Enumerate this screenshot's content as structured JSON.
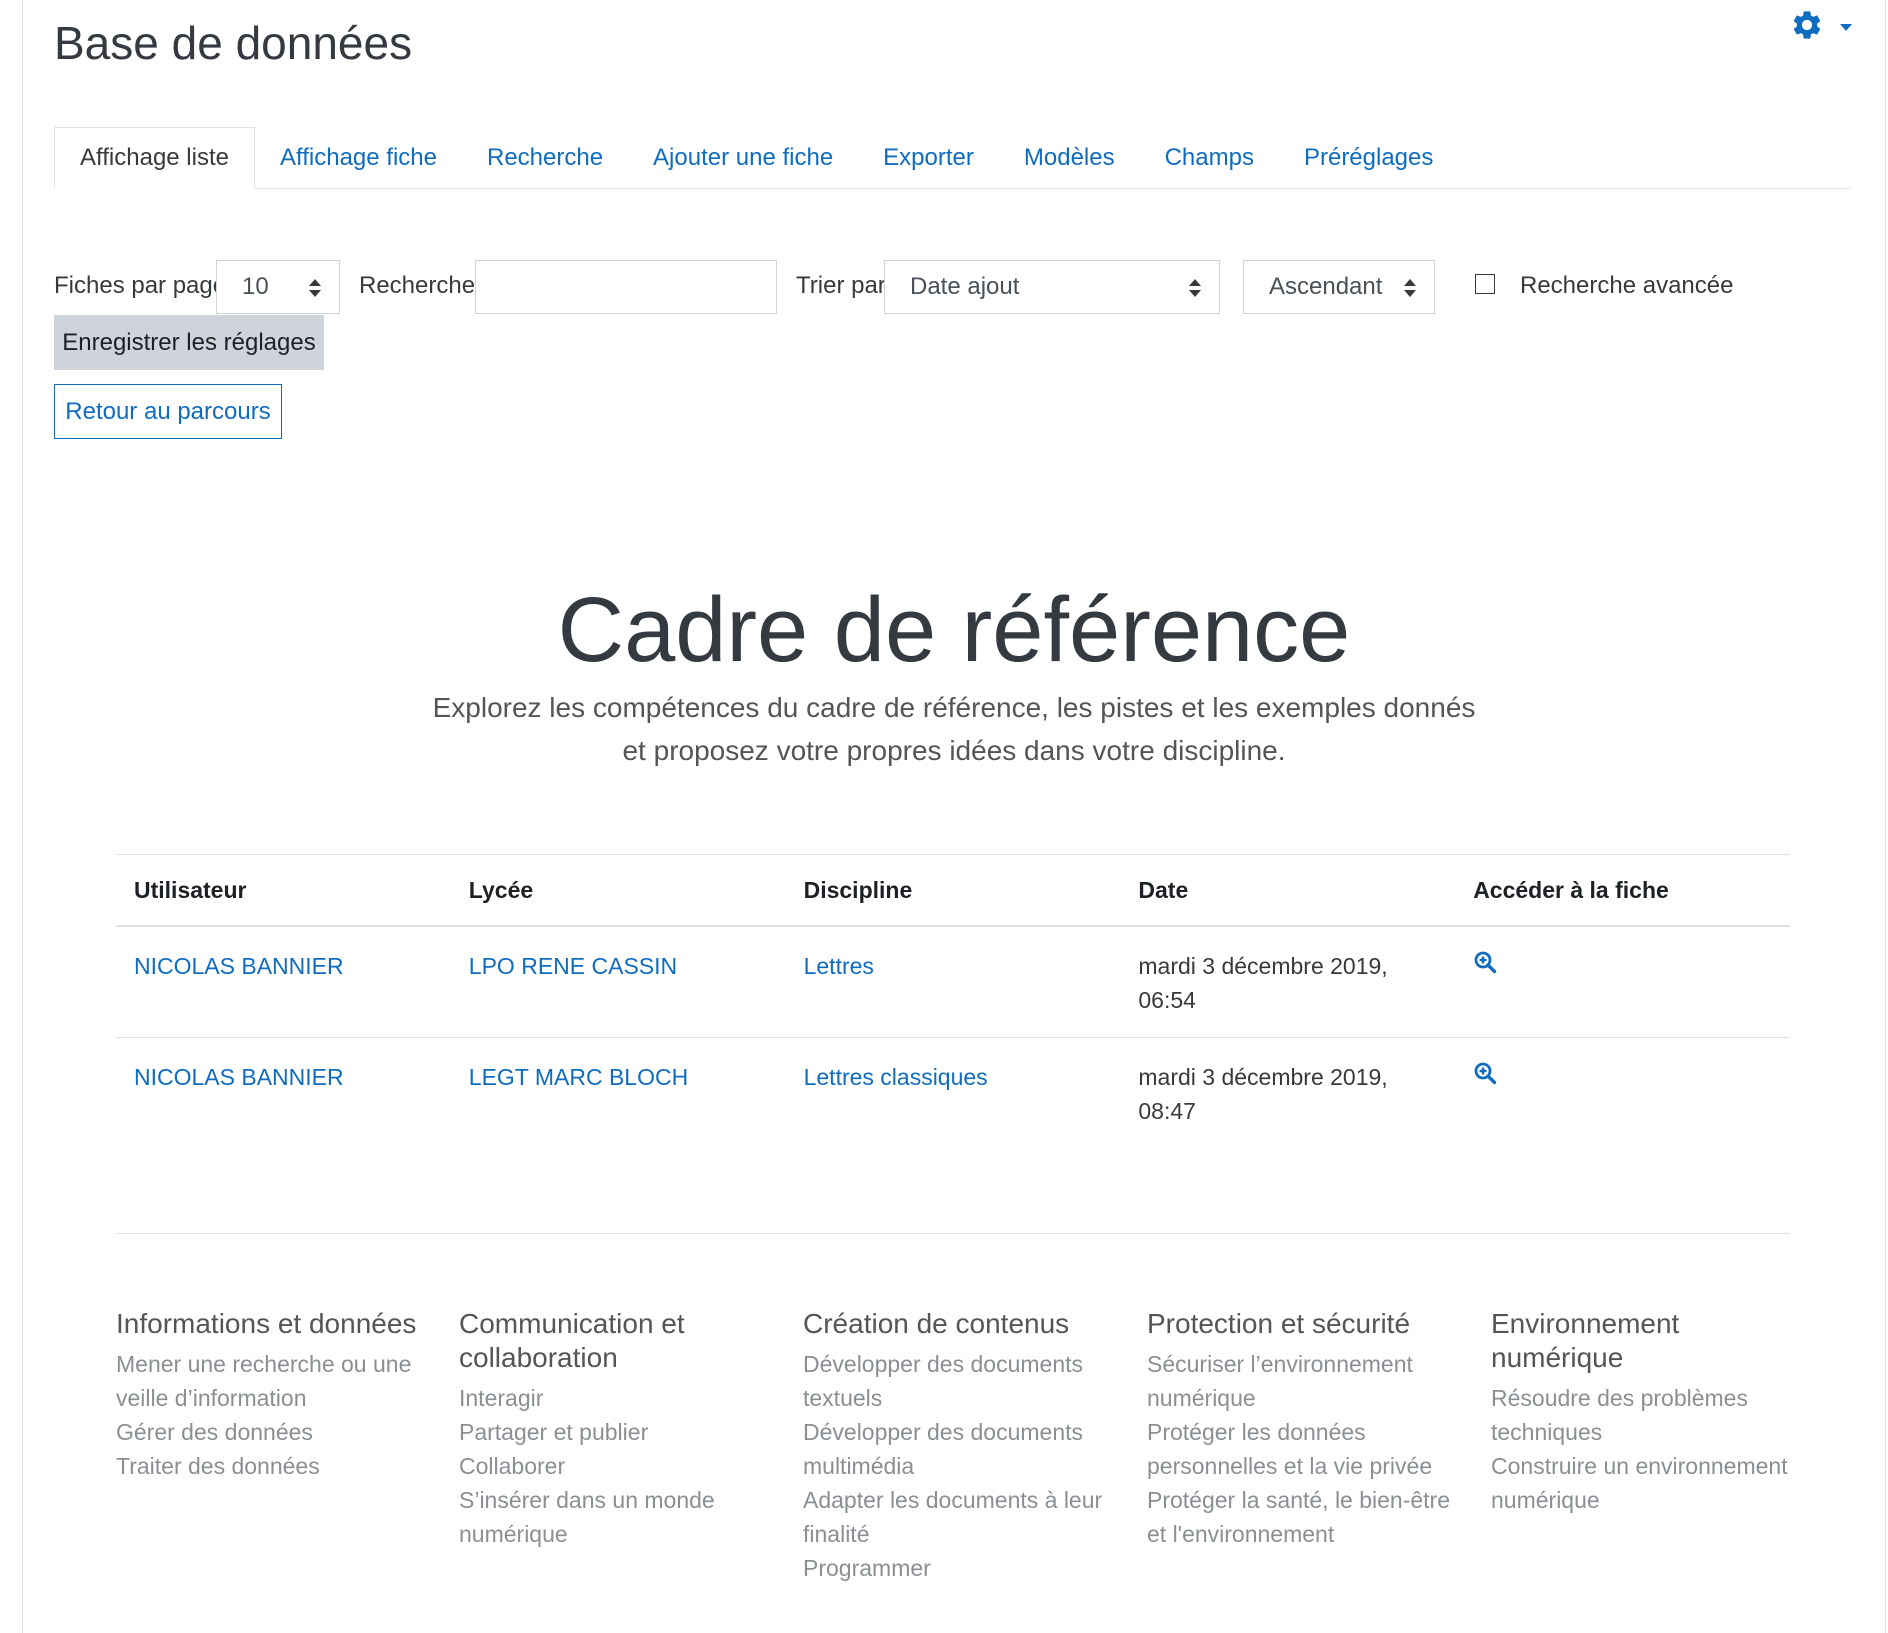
{
  "header": {
    "title": "Base de données"
  },
  "tabs": [
    {
      "label": "Affichage liste"
    },
    {
      "label": "Affichage fiche"
    },
    {
      "label": "Recherche"
    },
    {
      "label": "Ajouter une fiche"
    },
    {
      "label": "Exporter"
    },
    {
      "label": "Modèles"
    },
    {
      "label": "Champs"
    },
    {
      "label": "Préréglages"
    }
  ],
  "filters": {
    "per_page_label": "Fiches par page",
    "per_page_value": "10",
    "search_label": "Rechercher",
    "search_value": "",
    "sort_label": "Trier par",
    "sort_value": "Date ajout",
    "order_value": "Ascendant",
    "advanced_label": "Recherche avancée",
    "save_button": "Enregistrer les réglages"
  },
  "back_button": "Retour au parcours",
  "hero": {
    "title": "Cadre de référence",
    "subtitle": "Explorez les compétences du cadre de référence, les pistes et les exemples donnés et proposez votre propres idées dans votre discipline."
  },
  "table": {
    "headers": [
      "Utilisateur",
      "Lycée",
      "Discipline",
      "Date",
      "Accéder à la fiche"
    ],
    "rows": [
      {
        "user": "NICOLAS BANNIER",
        "school": "LPO RENE CASSIN",
        "discipline": "Lettres",
        "date_line1": "mardi 3 décembre 2019,",
        "date_line2": "06:54"
      },
      {
        "user": "NICOLAS BANNIER",
        "school": "LEGT MARC BLOCH",
        "discipline": "Lettres classiques",
        "date_line1": "mardi 3 décembre 2019,",
        "date_line2": "08:47"
      }
    ]
  },
  "footer": [
    {
      "title_1": "Informations et données",
      "title_2": "",
      "items": [
        "Mener une recherche ou une",
        "veille d’information",
        "Gérer des données",
        "Traiter des données"
      ]
    },
    {
      "title_1": "Communication et",
      "title_2": "collaboration",
      "items": [
        "Interagir",
        "Partager et publier",
        "Collaborer",
        "S’insérer dans un monde",
        "numérique"
      ]
    },
    {
      "title_1": "Création de contenus",
      "title_2": "",
      "items": [
        "Développer des documents",
        "textuels",
        "Développer des documents",
        "multimédia",
        "Adapter les documents à leur",
        "finalité",
        "Programmer"
      ]
    },
    {
      "title_1": "Protection et sécurité",
      "title_2": "",
      "items": [
        "Sécuriser l’environnement",
        "numérique",
        "Protéger les données",
        "personnelles et la vie privée",
        "Protéger la santé, le bien-être",
        "et l'environnement"
      ]
    },
    {
      "title_1": "Environnement",
      "title_2": "numérique",
      "items": [
        "Résoudre des problèmes",
        "techniques",
        "Construire un environnement",
        "numérique"
      ]
    }
  ],
  "colors": {
    "link": "#0f6cbf",
    "button_secondary": "#ced4da",
    "border": "#dee2e6"
  },
  "icons": {
    "settings": "gear-icon",
    "record_link": "zoom-in-icon"
  }
}
